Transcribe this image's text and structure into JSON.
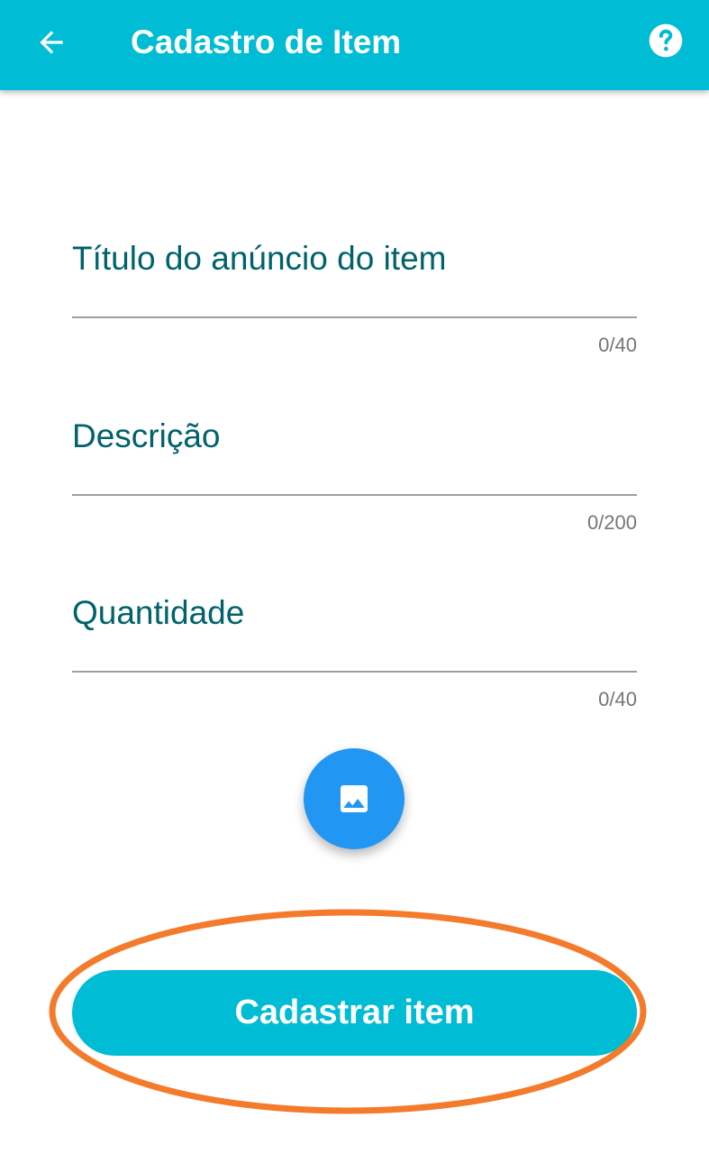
{
  "appbar": {
    "title": "Cadastro de Item",
    "back_icon": "arrow-left-icon",
    "help_icon": "help-circle-icon"
  },
  "form": {
    "fields": [
      {
        "label": "Título do anúncio do item",
        "counter": "0/40"
      },
      {
        "label": "Descrição",
        "counter": "0/200"
      },
      {
        "label": "Quantidade",
        "counter": "0/40"
      }
    ],
    "image_button_icon": "image-icon",
    "submit_label": "Cadastrar item"
  },
  "colors": {
    "primary": "#00bcd4",
    "fab": "#2196f3",
    "label": "#00626b",
    "highlight_ring": "#f47a2c"
  }
}
